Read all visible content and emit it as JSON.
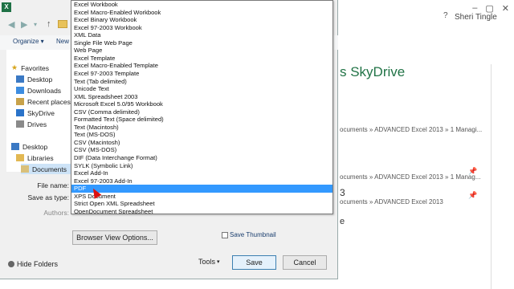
{
  "backstage": {
    "user": "Sheri Tingle",
    "help": "?",
    "window_controls": [
      "–",
      "▢",
      "✕"
    ],
    "title": "s SkyDrive",
    "recent": [
      {
        "path": "ocuments » ADVANCED Excel 2013 » 1 Managi..."
      },
      {
        "path": "ocuments » ADVANCED Excel 2013 » 1 Manag..."
      },
      {
        "path": "ocuments » ADVANCED Excel 2013"
      }
    ],
    "number": "3",
    "letter": "e"
  },
  "dialog": {
    "commands": {
      "organize": "Organize ▾",
      "new_folder": "New f"
    },
    "nav": [
      "◀",
      "▶",
      "▾",
      "↑"
    ],
    "nav_items": {
      "favorites": "Favorites",
      "desktop": "Desktop",
      "downloads": "Downloads",
      "recent_places": "Recent places",
      "skydrive": "SkyDrive",
      "drives": "Drives",
      "desktop2": "Desktop",
      "libraries": "Libraries",
      "documents": "Documents"
    },
    "labels": {
      "file_name": "File name:",
      "save_as_type": "Save as type:",
      "authors": "Authors:"
    },
    "browser_view_button": "Browser View Options...",
    "save_thumbnail": "Save Thumbnail",
    "tools": "Tools",
    "tools_arrow": "▾",
    "save": "Save",
    "cancel": "Cancel",
    "hide_folders": "Hide Folders"
  },
  "dropdown": {
    "items": [
      "Excel Workbook",
      "Excel Macro-Enabled Workbook",
      "Excel Binary Workbook",
      "Excel 97-2003 Workbook",
      "XML Data",
      "Single File Web Page",
      "Web Page",
      "Excel Template",
      "Excel Macro-Enabled Template",
      "Excel 97-2003 Template",
      "Text (Tab delimited)",
      "Unicode Text",
      "XML Spreadsheet 2003",
      "Microsoft Excel 5.0/95 Workbook",
      "CSV (Comma delimited)",
      "Formatted Text (Space delimited)",
      "Text (Macintosh)",
      "Text (MS-DOS)",
      "CSV (Macintosh)",
      "CSV (MS-DOS)",
      "DIF (Data Interchange Format)",
      "SYLK (Symbolic Link)",
      "Excel Add-In",
      "Excel 97-2003 Add-In",
      "PDF",
      "XPS Document",
      "Strict Open XML Spreadsheet",
      "OpenDocument Spreadsheet"
    ],
    "selected": "PDF"
  }
}
